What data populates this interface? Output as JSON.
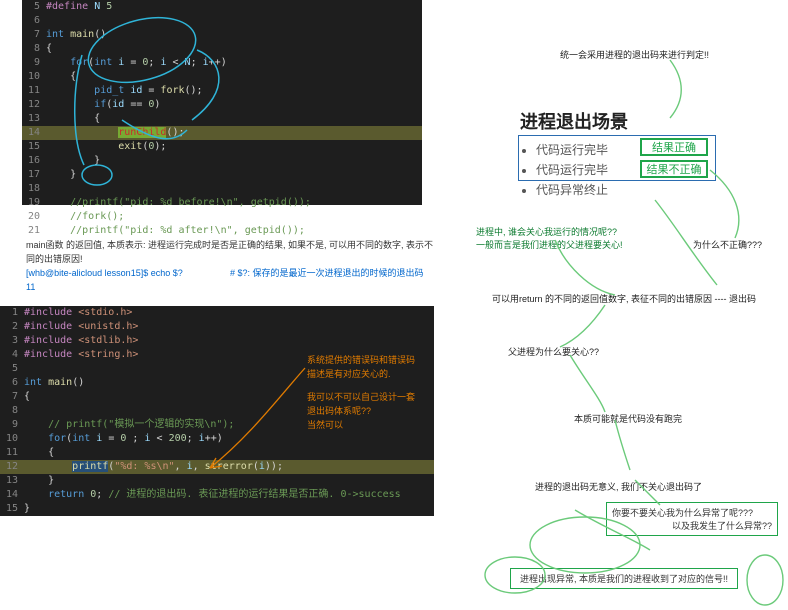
{
  "editor1": {
    "lines": [
      {
        "n": 5,
        "html": "<span class='inc'>#define</span> <span class='id'>N</span> <span class='num'>5</span>"
      },
      {
        "n": 6,
        "html": ""
      },
      {
        "n": 7,
        "html": "<span class='ty'>int</span> <span class='fn'>main</span>()"
      },
      {
        "n": 8,
        "html": "{"
      },
      {
        "n": 9,
        "html": "    <span class='kw'>for</span>(<span class='ty'>int</span> <span class='id'>i</span> = <span class='num'>0</span>; <span class='id'>i</span> &lt; <span class='id'>N</span>; <span class='id'>i</span>++)"
      },
      {
        "n": 10,
        "html": "    {"
      },
      {
        "n": 11,
        "html": "        <span class='ty'>pid_t</span> <span class='id'>id</span> = <span class='fn'>fork</span>();"
      },
      {
        "n": 12,
        "html": "        <span class='kw'>if</span>(<span class='id'>id</span> == <span class='num'>0</span>)"
      },
      {
        "n": 13,
        "html": "        {"
      },
      {
        "n": 14,
        "hl": true,
        "html": "            <span style='background:#7a3;'><span class='fn' style='color:#c92c2c'>runChild</span></span>();"
      },
      {
        "n": 15,
        "html": "            <span class='fn'>exit</span>(<span class='num'>0</span>);"
      },
      {
        "n": 16,
        "html": "        }"
      },
      {
        "n": 17,
        "html": "    }"
      },
      {
        "n": 18,
        "html": ""
      },
      {
        "n": 19,
        "html": "    <span class='cm'>//printf(\"pid: %d before!\\n\", getpid());</span>"
      },
      {
        "n": 20,
        "html": "    <span class='cm'>//fork();</span>"
      },
      {
        "n": 21,
        "html": "    <span class='cm'>//printf(\"pid: %d after!\\n\", getpid());</span>"
      }
    ]
  },
  "editor2": {
    "lines": [
      {
        "n": 1,
        "html": "<span class='inc'>#include</span> <span class='hdr'>&lt;stdio.h&gt;</span>"
      },
      {
        "n": 2,
        "html": "<span class='inc'>#include</span> <span class='hdr'>&lt;unistd.h&gt;</span>"
      },
      {
        "n": 3,
        "html": "<span class='inc'>#include</span> <span class='hdr'>&lt;stdlib.h&gt;</span>"
      },
      {
        "n": 4,
        "html": "<span class='inc'>#include</span> <span class='hdr'>&lt;string.h&gt;</span>"
      },
      {
        "n": 5,
        "html": ""
      },
      {
        "n": 6,
        "html": "<span class='ty'>int</span> <span class='fn'>main</span>()"
      },
      {
        "n": 7,
        "html": "{"
      },
      {
        "n": 8,
        "html": ""
      },
      {
        "n": 9,
        "html": "    <span class='cm'>// printf(\"模拟一个逻辑的实现\\n\");</span>"
      },
      {
        "n": 10,
        "html": "    <span class='kw'>for</span>(<span class='ty'>int</span> <span class='id'>i</span> = <span class='num'>0</span> ; <span class='id'>i</span> &lt; <span class='num'>200</span>; <span class='id'>i</span>++)"
      },
      {
        "n": 11,
        "html": "    {"
      },
      {
        "n": 12,
        "hl": true,
        "html": "        <span style='background:#264f78;'><span class='fn'>printf</span></span>(<span class='str'>\"%d: %s\\n\"</span>, <span class='id'>i</span>, <span class='fn'>strerror</span>(<span class='id'>i</span>));"
      },
      {
        "n": 13,
        "html": "    }"
      },
      {
        "n": 14,
        "html": "    <span class='kw'>return</span> <span class='num'>0</span>; <span class='cm'>// 进程的退出码. 表征进程的运行结果是否正确. 0-&gt;success</span>"
      },
      {
        "n": 15,
        "html": "}"
      }
    ]
  },
  "mid": {
    "line1": "main函数 的返回值, 本质表示: 进程运行完成时是否是正确的结果, 如果不是, 可以用不同的数字, 表示不同的出错原因!",
    "shell": "[whb@bite-alicloud lesson15]$ echo $?",
    "comment": "# $?: 保存的是最近一次进程退出的时候的退出码",
    "val": "11"
  },
  "right": {
    "top": "统一会采用进程的退出码来进行判定!!",
    "heading": "进程退出场景",
    "b1": "代码运行完毕",
    "b2": "代码运行完毕",
    "b3": "代码异常终止",
    "r1": "结果正确",
    "r2": "结果不正确",
    "q1a": "进程中, 谁会关心我运行的情况呢??",
    "q1b": "一般而言是我们进程的父进程要关心!",
    "q2": "为什么不正确???",
    "ret": "可以用return 的不同的返回值数字, 表征不同的出错原因 ---- 退出码",
    "q3": "父进程为什么要关心??",
    "ans3": "本质可能就是代码没有跑完",
    "q4": "进程的退出码无意义, 我们不关心退出码了",
    "box1a": "你要不要关心我为什么异常了呢???",
    "box1b": "以及我发生了什么异常??",
    "box2": "进程出现异常, 本质是我们的进程收到了对应的信号!!"
  },
  "side": {
    "l1": "系统提供的错误码和错误码",
    "l2": "描述是有对应关心的.",
    "l3": "我可以不可以自己设计一套",
    "l4": "退出码体系呢??",
    "l5": "当然可以"
  }
}
